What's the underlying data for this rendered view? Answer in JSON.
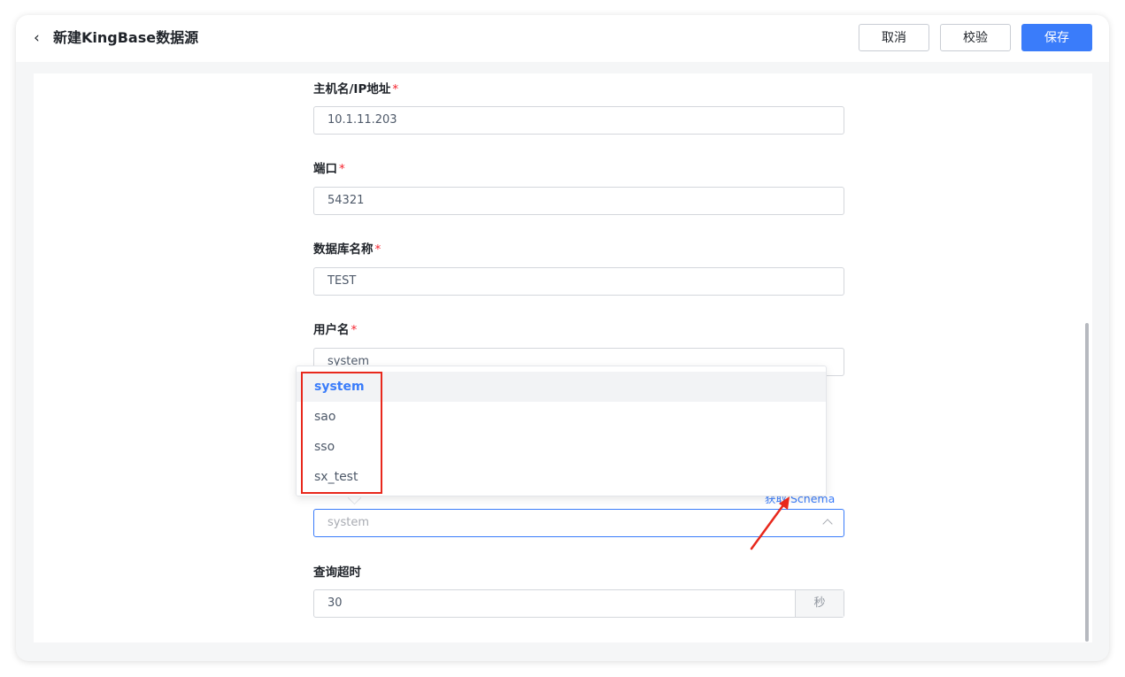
{
  "header": {
    "back_icon": "chevron-left-icon",
    "title": "新建KingBase数据源",
    "buttons": {
      "cancel": "取消",
      "validate": "校验",
      "save": "保存"
    }
  },
  "form": {
    "host": {
      "label": "主机名/IP地址",
      "required": "*",
      "value": "10.1.11.203"
    },
    "port": {
      "label": "端口",
      "required": "*",
      "value": "54321"
    },
    "database": {
      "label": "数据库名称",
      "required": "*",
      "value": "TEST"
    },
    "username": {
      "label": "用户名",
      "required": "*",
      "value": "system"
    },
    "schema": {
      "value": "system",
      "get_schema_link": "获取 Schema"
    },
    "timeout": {
      "label": "查询超时",
      "value": "30",
      "unit": "秒"
    }
  },
  "dropdown": {
    "options": [
      "system",
      "sao",
      "sso",
      "sx_test"
    ],
    "selected": "system"
  },
  "colors": {
    "primary": "#3a7cfa",
    "required": "#f5222d",
    "annotation": "#e8281c"
  }
}
